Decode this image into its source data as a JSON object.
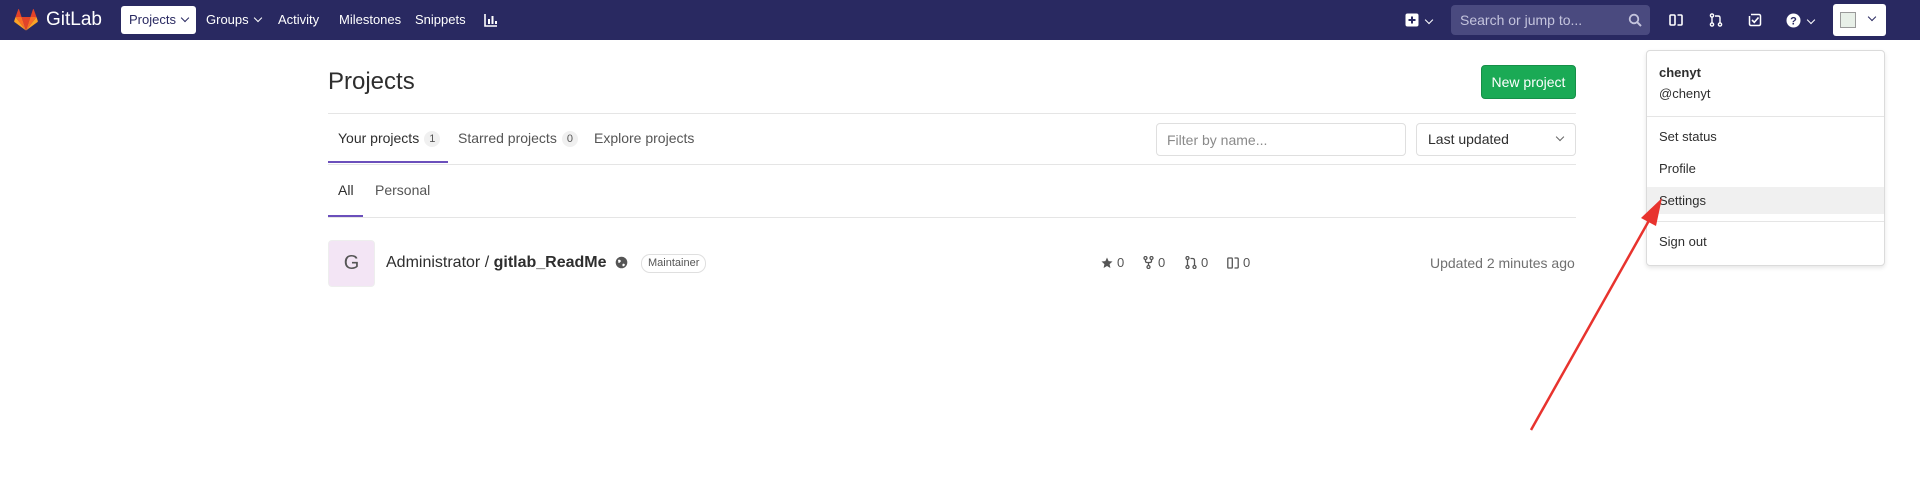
{
  "navbar": {
    "brand": "GitLab",
    "links": [
      "Projects",
      "Groups",
      "Activity",
      "Milestones",
      "Snippets"
    ],
    "search_placeholder": "Search or jump to..."
  },
  "page": {
    "title": "Projects",
    "new_project": "New project",
    "tabs": [
      {
        "label": "Your projects",
        "count": "1"
      },
      {
        "label": "Starred projects",
        "count": "0"
      },
      {
        "label": "Explore projects"
      }
    ],
    "filter_placeholder": "Filter by name...",
    "sort_selected": "Last updated",
    "subtabs": [
      "All",
      "Personal"
    ]
  },
  "project": {
    "avatar_letter": "G",
    "namespace": "Administrator / ",
    "name": "gitlab_ReadMe",
    "role": "Maintainer",
    "stars": "0",
    "forks": "0",
    "merge_requests": "0",
    "issues": "0",
    "updated": "Updated 2 minutes ago"
  },
  "user_menu": {
    "name": "chenyt",
    "username": "@chenyt",
    "items": [
      "Set status",
      "Profile",
      "Settings",
      "Sign out"
    ]
  },
  "colors": {
    "navbar": "#292961",
    "accent": "#6b4fbb",
    "success": "#1aaa55",
    "annotation": "#e8332e"
  }
}
